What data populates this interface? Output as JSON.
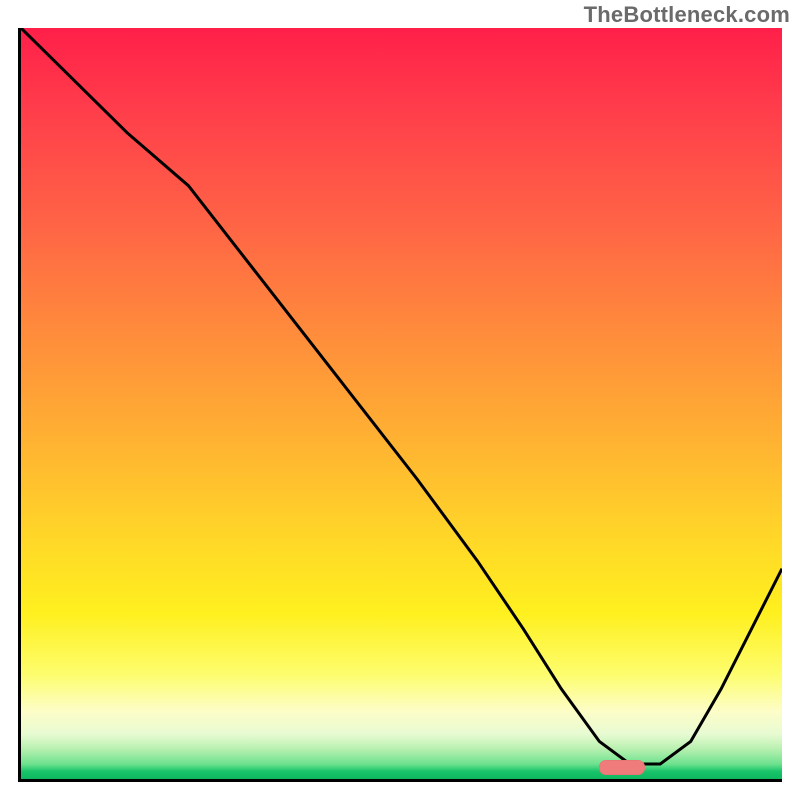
{
  "watermark": "TheBottleneck.com",
  "colors": {
    "curve_stroke": "#000000",
    "marker_fill": "#ef7b7b",
    "axis_stroke": "#000000"
  },
  "chart_data": {
    "type": "line",
    "title": "",
    "xlabel": "",
    "ylabel": "",
    "xlim": [
      0,
      100
    ],
    "ylim": [
      0,
      100
    ],
    "series": [
      {
        "name": "bottleneck-curve",
        "x": [
          0,
          6,
          14,
          22,
          32,
          42,
          52,
          60,
          66,
          71,
          76,
          80,
          84,
          88,
          92,
          96,
          100
        ],
        "y": [
          100,
          94,
          86,
          79,
          66,
          53,
          40,
          29,
          20,
          12,
          5,
          2,
          2,
          5,
          12,
          20,
          28
        ]
      }
    ],
    "marker": {
      "name": "optimal-range",
      "x_start": 76,
      "x_end": 82,
      "y": 1.5,
      "height": 2
    },
    "annotations": []
  }
}
